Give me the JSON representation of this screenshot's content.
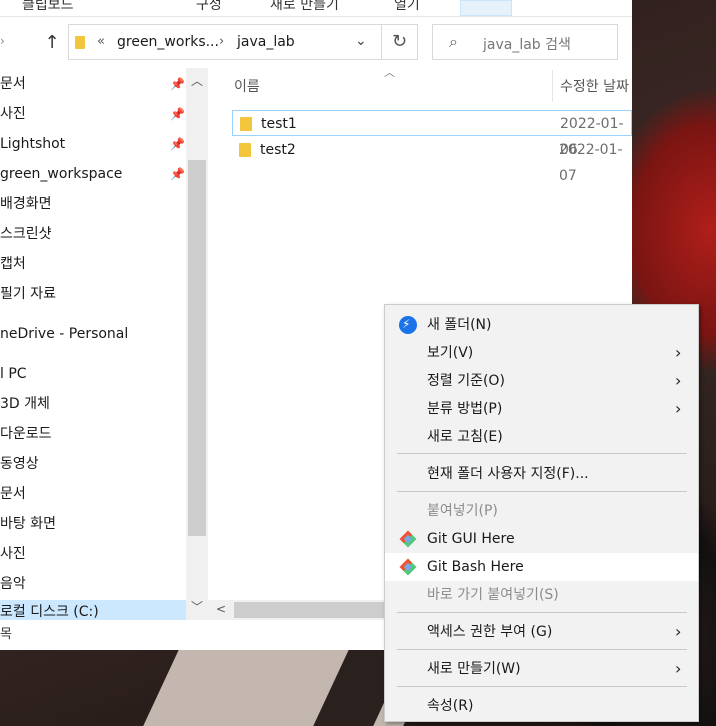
{
  "ribbon": {
    "tabs": [
      "클립보드",
      "구성",
      "새로 만들기",
      "열기"
    ]
  },
  "address": {
    "crumbs": [
      "green_works...",
      "java_lab"
    ],
    "overflow": "«"
  },
  "search": {
    "placeholder": "java_lab 검색"
  },
  "nav": {
    "items": [
      {
        "label": "문서",
        "pinned": true
      },
      {
        "label": "사진",
        "pinned": true
      },
      {
        "label": "Lightshot",
        "pinned": true
      },
      {
        "label": "green_workspace",
        "pinned": true
      },
      {
        "label": "배경화면"
      },
      {
        "label": "스크린샷"
      },
      {
        "label": "캡처"
      },
      {
        "label": "필기 자료"
      },
      {
        "label": "neDrive - Personal"
      },
      {
        "label": "l PC"
      },
      {
        "label": "3D 개체"
      },
      {
        "label": "다운로드"
      },
      {
        "label": "동영상"
      },
      {
        "label": "문서"
      },
      {
        "label": "바탕 화면"
      },
      {
        "label": "사진"
      },
      {
        "label": "음악"
      },
      {
        "label": "로컬 디스크 (C:)",
        "selected": true
      }
    ]
  },
  "filelist": {
    "columns": {
      "name": "이름",
      "modified": "수정한 날짜"
    },
    "rows": [
      {
        "name": "test1",
        "date": "2022-01-06"
      },
      {
        "name": "test2",
        "date": "2022-01-07"
      }
    ]
  },
  "status": {
    "text": "목"
  },
  "context_menu": {
    "items": [
      {
        "label": "새 폴더(N)",
        "icon": "new-folder-icon"
      },
      {
        "label": "보기(V)",
        "submenu": true
      },
      {
        "label": "정렬 기준(O)",
        "submenu": true
      },
      {
        "label": "분류 방법(P)",
        "submenu": true
      },
      {
        "label": "새로 고침(E)"
      },
      {
        "label": "현재 폴더 사용자 지정(F)..."
      },
      {
        "label": "붙여넣기(P)",
        "disabled": true
      },
      {
        "label": "Git GUI Here",
        "icon": "git-icon"
      },
      {
        "label": "Git Bash Here",
        "icon": "git-icon",
        "hover": true
      },
      {
        "label": "바로 가기 붙여넣기(S)",
        "disabled": true
      },
      {
        "label": "액세스 권한 부여 (G)",
        "submenu": true
      },
      {
        "label": "새로 만들기(W)",
        "submenu": true
      },
      {
        "label": "속성(R)"
      }
    ]
  }
}
